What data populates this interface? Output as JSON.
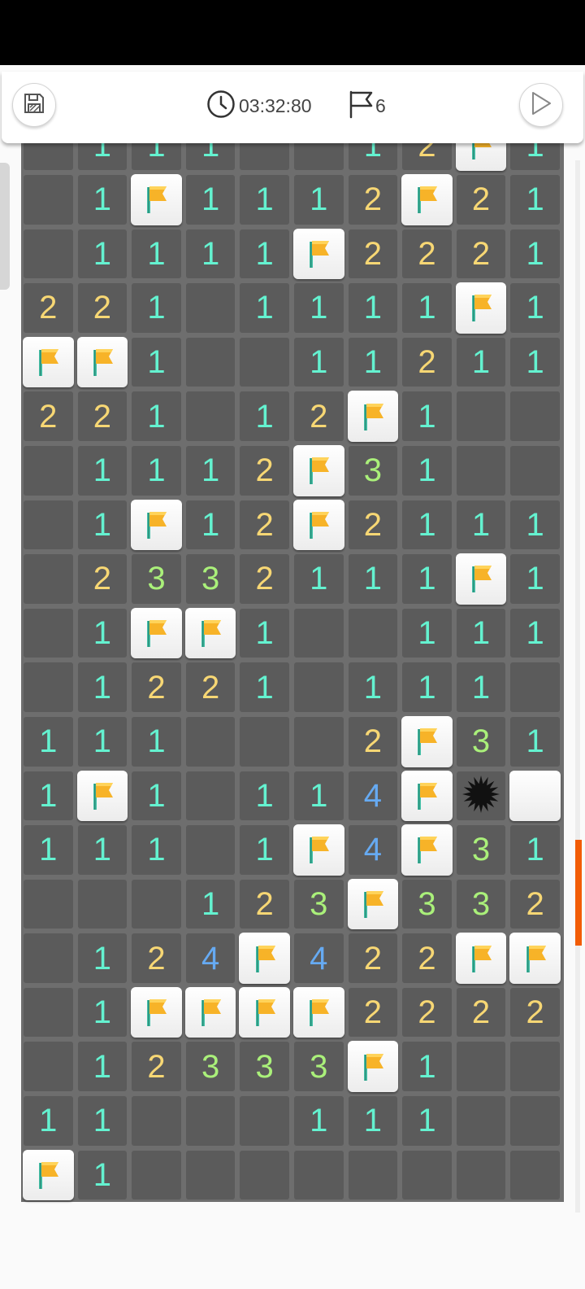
{
  "toolbar": {
    "save_icon": "save-icon",
    "timer_icon": "clock-icon",
    "timer": "03:32:80",
    "flag_icon": "flag-outline-icon",
    "flags": "6",
    "play_icon": "play-icon"
  },
  "colors": {
    "1": "#64f2d0",
    "2": "#f7d774",
    "3": "#aaf07a",
    "4": "#66aaf2",
    "board": "#6e6e6e",
    "cell": "#5b5b5b",
    "flag": "#f7b328",
    "accent": "#f25c05"
  },
  "board": {
    "cols": 10,
    "partial_top_row": [
      "",
      "1",
      "1",
      "1",
      "",
      "",
      "1",
      "2",
      "F",
      "1"
    ],
    "rows": [
      [
        "",
        "1",
        "F",
        "1",
        "1",
        "1",
        "2",
        "F",
        "2",
        "1"
      ],
      [
        "",
        "1",
        "1",
        "1",
        "1",
        "F",
        "2",
        "2",
        "2",
        "1"
      ],
      [
        "2",
        "2",
        "1",
        "",
        "1",
        "1",
        "1",
        "1",
        "F",
        "1"
      ],
      [
        "F",
        "F",
        "1",
        "",
        "",
        "1",
        "1",
        "2",
        "1",
        "1"
      ],
      [
        "2",
        "2",
        "1",
        "",
        "1",
        "2",
        "F",
        "1",
        "",
        ""
      ],
      [
        "",
        "1",
        "1",
        "1",
        "2",
        "F",
        "3",
        "1",
        "",
        ""
      ],
      [
        "",
        "1",
        "F",
        "1",
        "2",
        "F",
        "2",
        "1",
        "1",
        "1"
      ],
      [
        "",
        "2",
        "3",
        "3",
        "2",
        "1",
        "1",
        "1",
        "F",
        "1"
      ],
      [
        "",
        "1",
        "F",
        "F",
        "1",
        "",
        "",
        "1",
        "1",
        "1"
      ],
      [
        "",
        "1",
        "2",
        "2",
        "1",
        "",
        "1",
        "1",
        "1",
        ""
      ],
      [
        "1",
        "1",
        "1",
        "",
        "",
        "",
        "2",
        "F",
        "3",
        "1"
      ],
      [
        "1",
        "F",
        "1",
        "",
        "1",
        "1",
        "4",
        "F",
        "M",
        "H"
      ],
      [
        "1",
        "1",
        "1",
        "",
        "1",
        "F",
        "4",
        "F",
        "3",
        "1"
      ],
      [
        "",
        "",
        "",
        "1",
        "2",
        "3",
        "F",
        "3",
        "3",
        "2"
      ],
      [
        "",
        "1",
        "2",
        "4",
        "F",
        "4",
        "2",
        "2",
        "F",
        "F"
      ],
      [
        "",
        "1",
        "F",
        "F",
        "F",
        "F",
        "2",
        "2",
        "2",
        "2"
      ],
      [
        "",
        "1",
        "2",
        "3",
        "3",
        "3",
        "F",
        "1",
        "",
        ""
      ],
      [
        "1",
        "1",
        "",
        "",
        "",
        "1",
        "1",
        "1",
        "",
        ""
      ],
      [
        "F",
        "1",
        "",
        "",
        "",
        "",
        "",
        "",
        "",
        ""
      ]
    ]
  }
}
